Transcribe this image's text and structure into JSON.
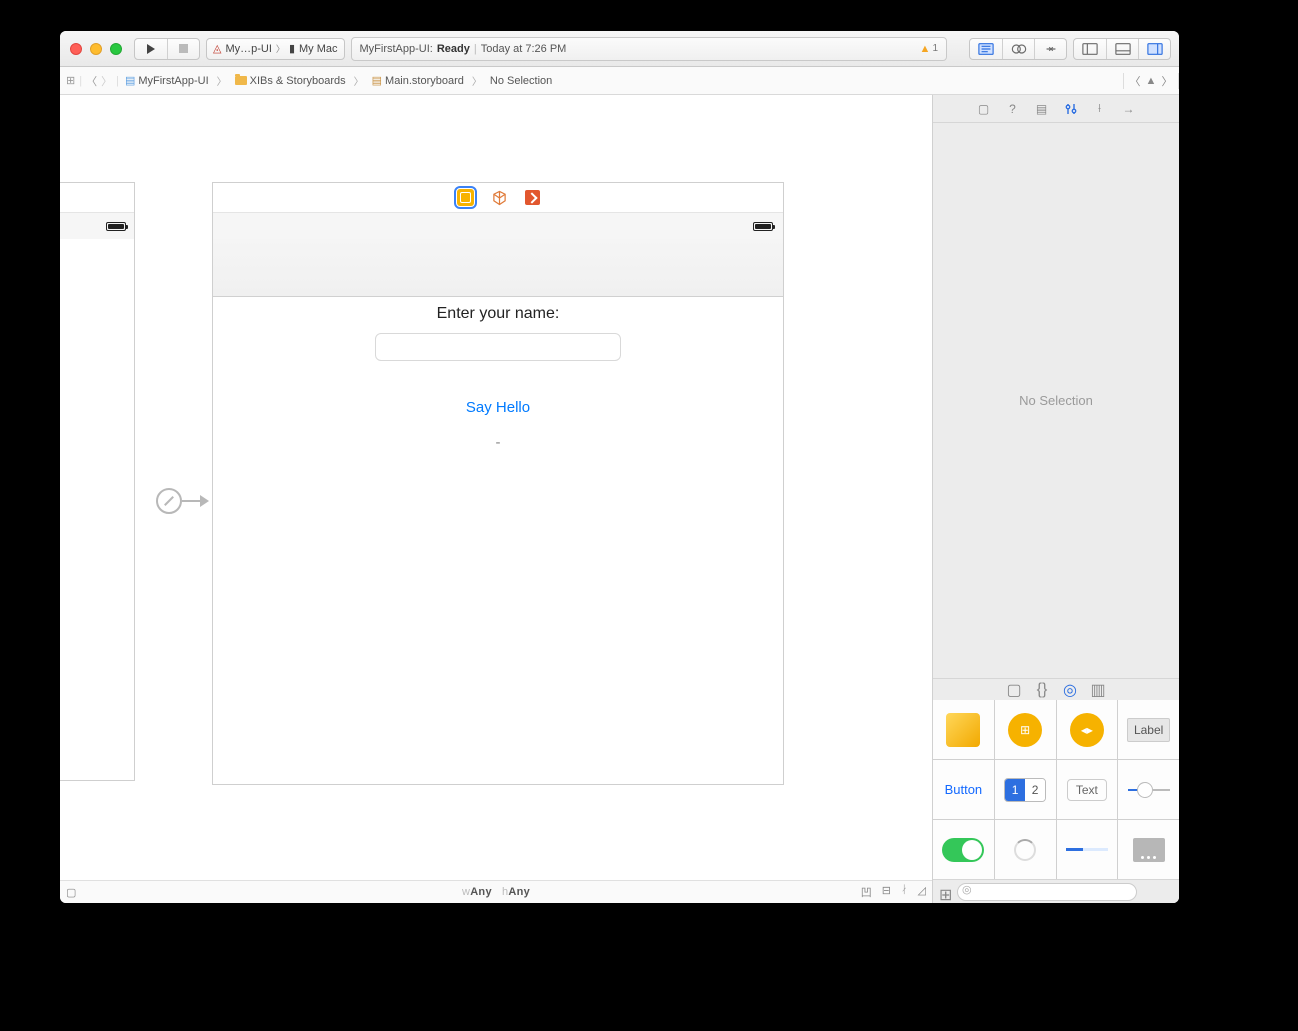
{
  "toolbar": {
    "scheme_app": "My…p-UI",
    "scheme_device": "My Mac",
    "activity_project": "MyFirstApp-UI:",
    "activity_status": "Ready",
    "activity_time": "Today at 7:26 PM",
    "warning_count": "1"
  },
  "jumpbar": {
    "items": [
      "MyFirstApp-UI",
      "XIBs & Storyboards",
      "Main.storyboard",
      "No Selection"
    ]
  },
  "scene": {
    "prompt_label": "Enter your name:",
    "button_title": "Say Hello",
    "result_label": "-"
  },
  "sizeclass": {
    "w_prefix": "w",
    "w_value": "Any",
    "h_prefix": "h",
    "h_value": "Any"
  },
  "inspector": {
    "empty_text": "No Selection"
  },
  "library": {
    "items": {
      "label": "Label",
      "button": "Button",
      "seg_a": "1",
      "seg_b": "2",
      "text": "Text"
    },
    "filter_placeholder": ""
  }
}
